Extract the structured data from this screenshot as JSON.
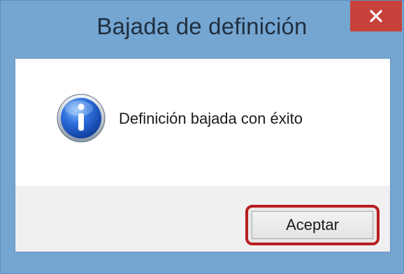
{
  "dialog": {
    "title": "Bajada de definición",
    "close_icon": "close-icon",
    "message_icon": "information-icon",
    "message": "Definición bajada con éxito",
    "ok_label": "Aceptar"
  },
  "colors": {
    "window_frame": "#75a5d1",
    "close_button": "#c7423a",
    "footer": "#f0f0f0",
    "highlight": "#b81e1e"
  }
}
